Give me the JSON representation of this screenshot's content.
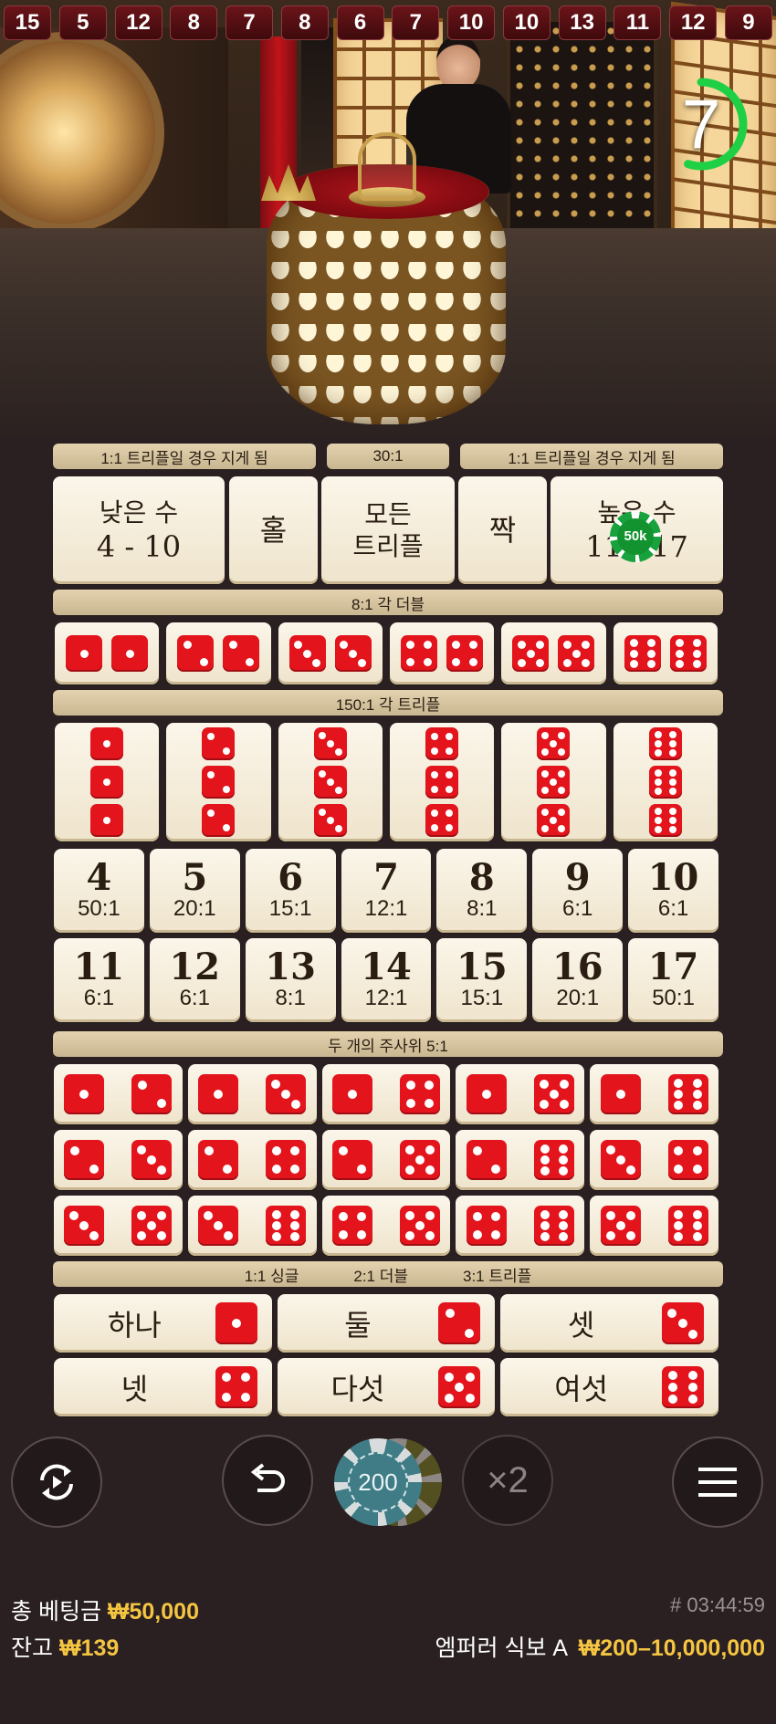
{
  "history": [
    "15",
    "5",
    "12",
    "8",
    "7",
    "8",
    "6",
    "7",
    "10",
    "10",
    "13",
    "11",
    "12",
    "9"
  ],
  "timer": {
    "value": "7",
    "fraction_remaining": 0.55,
    "color": "#1fd045"
  },
  "board": {
    "top_labels": {
      "small": "1:1 트리플일 경우 지게 됨",
      "triple": "30:1",
      "big": "1:1 트리플일 경우 지게 됨"
    },
    "main_bets": {
      "small_title": "낮은 수",
      "small_range": "4 - 10",
      "odd": "홀",
      "any_triple_line1": "모든",
      "any_triple_line2": "트리플",
      "even": "짝",
      "big_title": "높은 수",
      "big_range": "11 - 17",
      "big_chip": "50k"
    },
    "doubles_label": "8:1 각 더블",
    "triples_label": "150:1 각 트리플",
    "totals_top": [
      {
        "num": "4",
        "pay": "50:1"
      },
      {
        "num": "5",
        "pay": "20:1"
      },
      {
        "num": "6",
        "pay": "15:1"
      },
      {
        "num": "7",
        "pay": "12:1"
      },
      {
        "num": "8",
        "pay": "8:1"
      },
      {
        "num": "9",
        "pay": "6:1"
      },
      {
        "num": "10",
        "pay": "6:1"
      }
    ],
    "totals_bottom": [
      {
        "num": "11",
        "pay": "6:1"
      },
      {
        "num": "12",
        "pay": "6:1"
      },
      {
        "num": "13",
        "pay": "8:1"
      },
      {
        "num": "14",
        "pay": "12:1"
      },
      {
        "num": "15",
        "pay": "15:1"
      },
      {
        "num": "16",
        "pay": "20:1"
      },
      {
        "num": "17",
        "pay": "50:1"
      }
    ],
    "two_dice_label": "두 개의 주사위 5:1",
    "two_dice_pairs": [
      [
        1,
        2
      ],
      [
        1,
        3
      ],
      [
        1,
        4
      ],
      [
        1,
        5
      ],
      [
        1,
        6
      ],
      [
        2,
        3
      ],
      [
        2,
        4
      ],
      [
        2,
        5
      ],
      [
        2,
        6
      ],
      [
        3,
        4
      ],
      [
        3,
        5
      ],
      [
        3,
        6
      ],
      [
        4,
        5
      ],
      [
        4,
        6
      ],
      [
        5,
        6
      ]
    ],
    "single_labels": {
      "single": "1:1 싱글",
      "double": "2:1 더블",
      "triple": "3:1 트리플"
    },
    "singles": [
      {
        "label": "하나",
        "die": 1
      },
      {
        "label": "둘",
        "die": 2
      },
      {
        "label": "셋",
        "die": 3
      },
      {
        "label": "넷",
        "die": 4
      },
      {
        "label": "다섯",
        "die": 5
      },
      {
        "label": "여섯",
        "die": 6
      }
    ]
  },
  "controls": {
    "autoplay_icon": "autoplay-icon",
    "undo_icon": "undo-icon",
    "chip_value": "200",
    "double_label": "×2",
    "menu_icon": "menu-icon"
  },
  "footer": {
    "total_bet_label": "총 베팅금",
    "total_bet_value": "₩50,000",
    "balance_label": "잔고",
    "balance_value": "₩139",
    "round_id": "# 03:44:59",
    "table_name": "엠퍼러 식보 A",
    "limits": "₩200–10,000,000"
  },
  "colors": {
    "die_red": "#e3141c",
    "gold": "#f5c542",
    "board_cream": "#fbf6ea"
  }
}
